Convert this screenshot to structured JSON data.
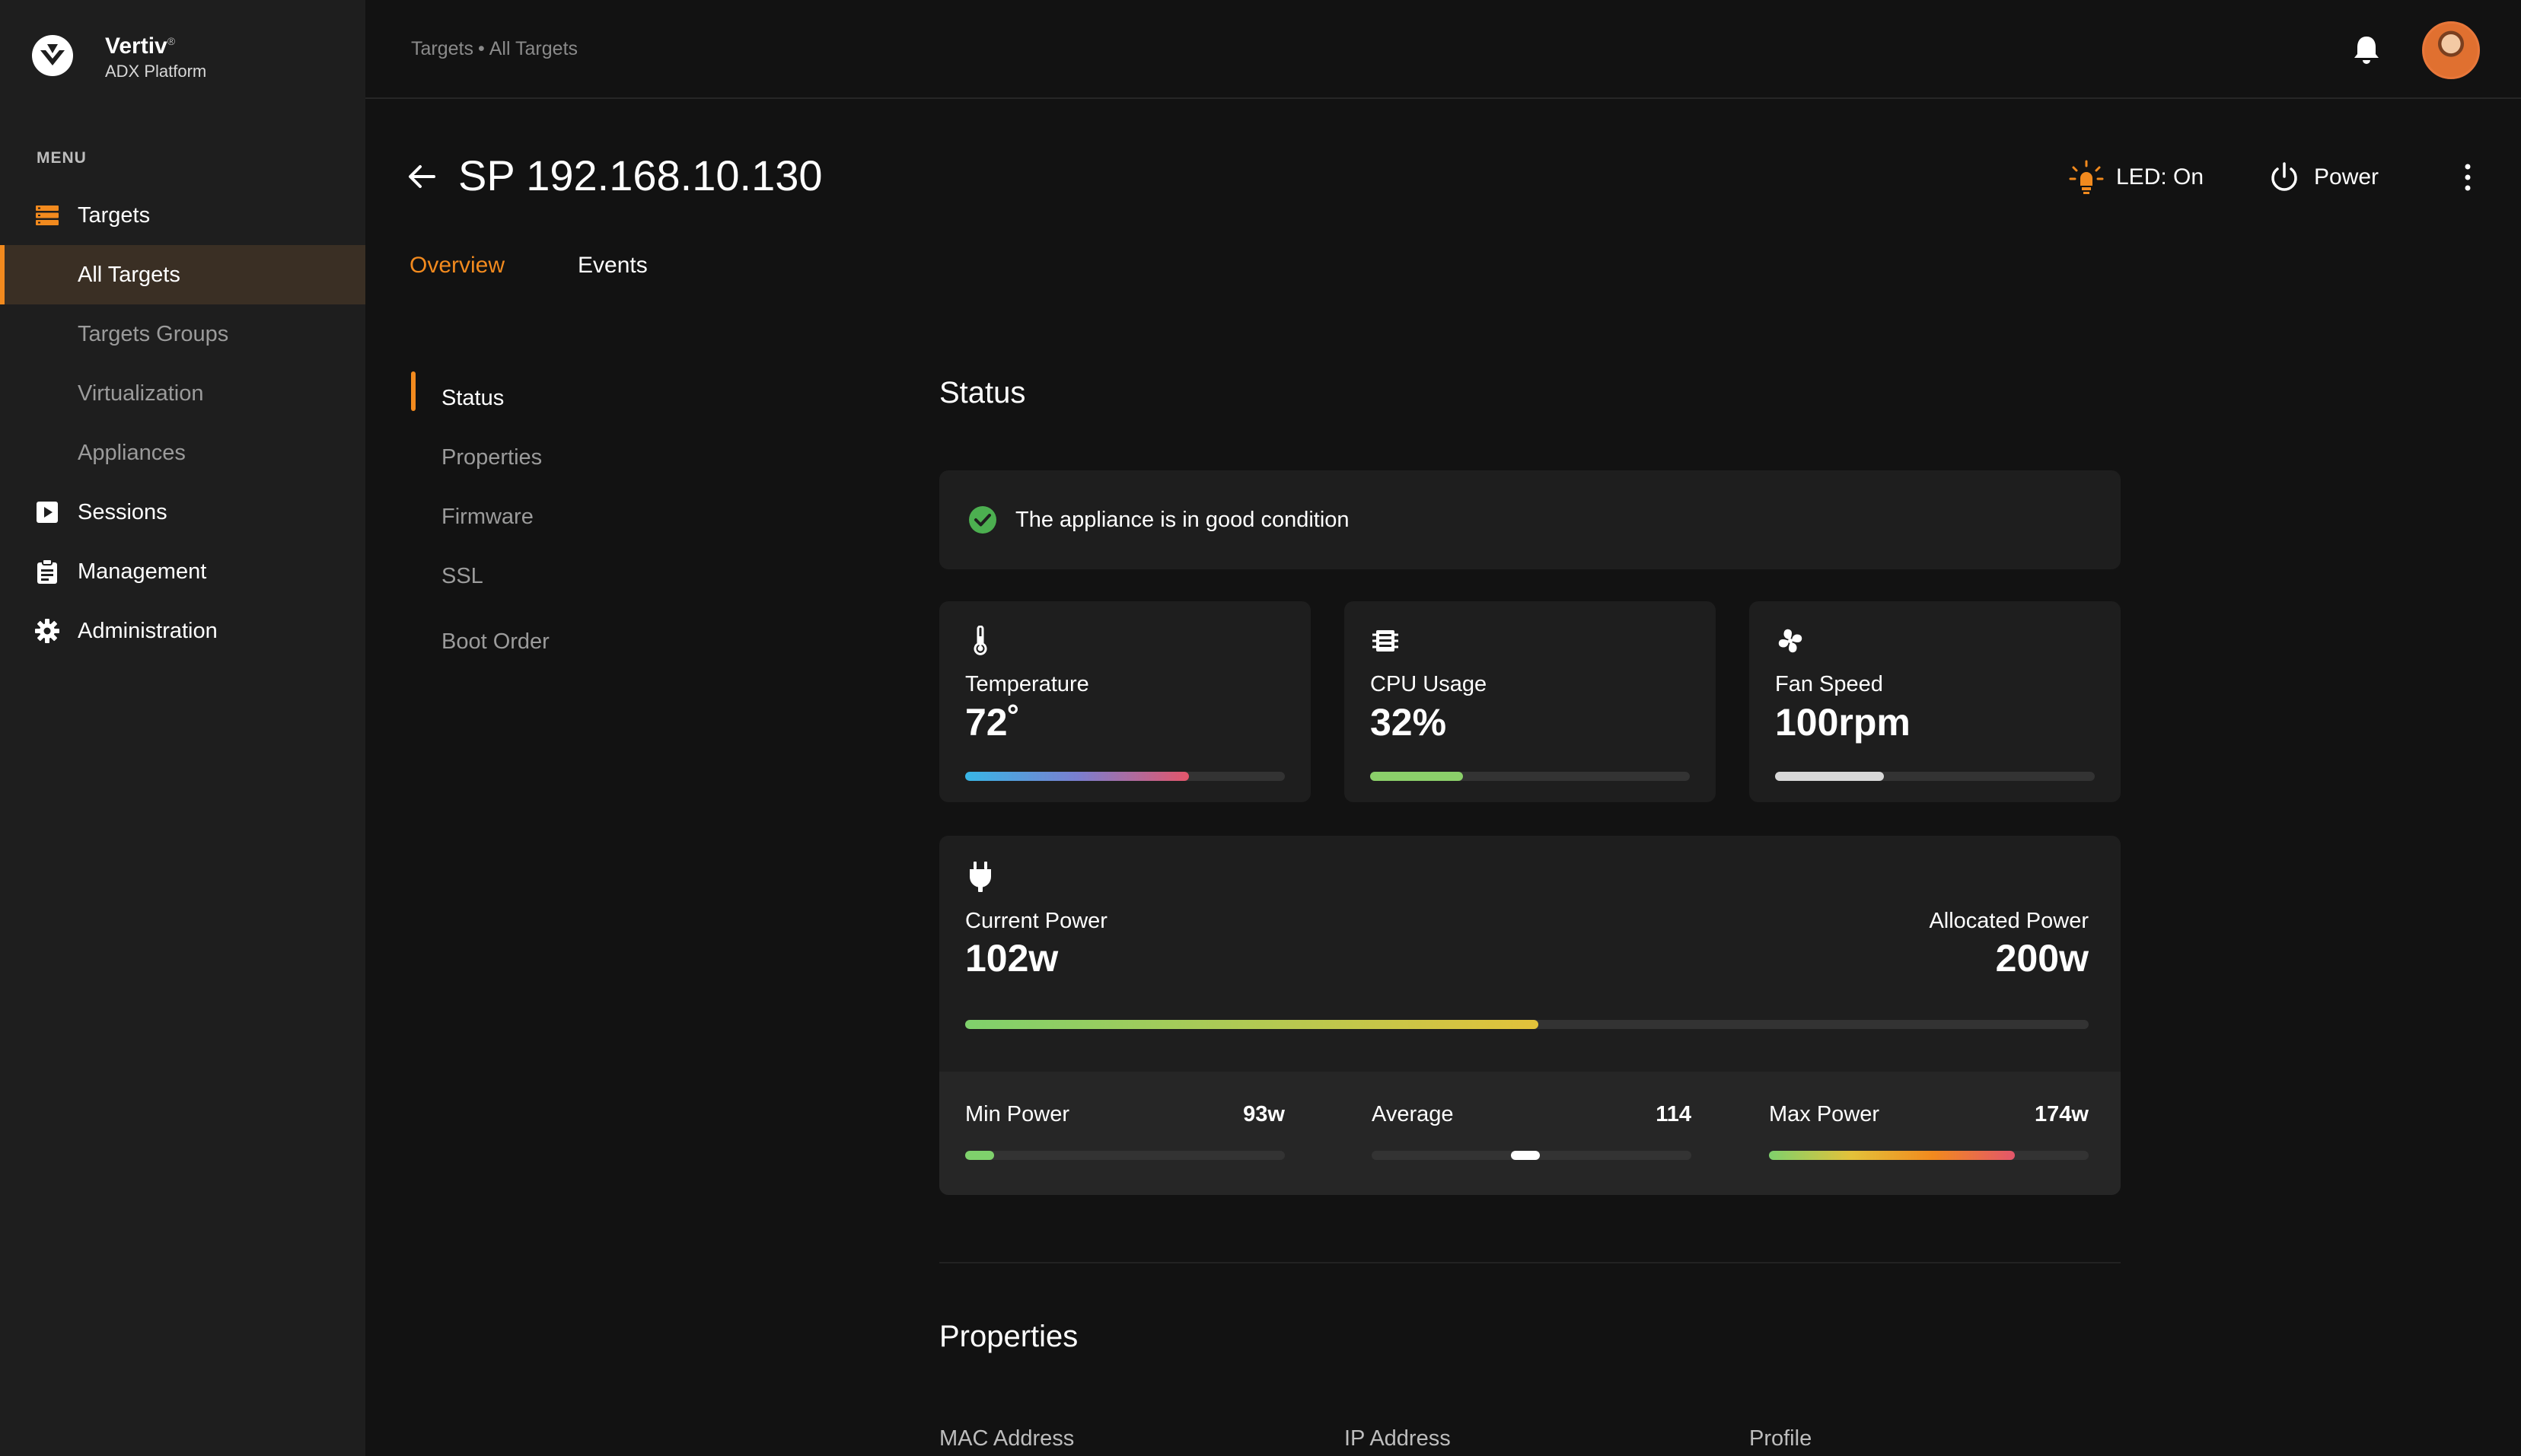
{
  "brand": {
    "name": "Vertiv",
    "mark": "®",
    "subtitle": "ADX Platform"
  },
  "sidebar": {
    "menu_title": "MENU",
    "items": [
      {
        "label": "Targets",
        "icon": "targets-icon"
      },
      {
        "label": "All Targets",
        "active": true
      },
      {
        "label": "Targets Groups"
      },
      {
        "label": "Virtualization"
      },
      {
        "label": "Appliances"
      },
      {
        "label": "Sessions",
        "icon": "sessions-icon"
      },
      {
        "label": "Management",
        "icon": "clipboard-icon"
      },
      {
        "label": "Administration",
        "icon": "gear-icon"
      }
    ]
  },
  "header": {
    "breadcrumb": [
      "Targets",
      "All Targets"
    ],
    "separator": "•"
  },
  "page": {
    "title": "SP 192.168.10.130",
    "led_label": "LED: On",
    "power_label": "Power",
    "tabs": [
      {
        "label": "Overview",
        "active": true
      },
      {
        "label": "Events"
      }
    ]
  },
  "section_nav": [
    "Status",
    "Properties",
    "Firmware",
    "SSL",
    "Boot Order"
  ],
  "status": {
    "heading": "Status",
    "condition": "The appliance is in good condition",
    "metrics": [
      {
        "label": "Temperature",
        "value": "72˚",
        "level": 0.7,
        "icon": "thermometer-icon"
      },
      {
        "label": "CPU Usage",
        "value": "32%",
        "level": 0.29,
        "icon": "chip-icon"
      },
      {
        "label": "Fan Speed",
        "value": "100rpm",
        "level": 0.34,
        "icon": "fan-icon"
      }
    ],
    "power": {
      "current_label": "Current Power",
      "current_value": "102w",
      "allocated_label": "Allocated Power",
      "allocated_value": "200w",
      "level": 0.51,
      "stats": [
        {
          "label": "Min Power",
          "value": "93w",
          "level": 0.09
        },
        {
          "label": "Average",
          "value": "114",
          "marker": 0.48
        },
        {
          "label": "Max Power",
          "value": "174w",
          "level": 0.77
        }
      ]
    }
  },
  "properties": {
    "heading": "Properties",
    "columns": [
      "MAC Address",
      "IP Address",
      "Profile"
    ]
  },
  "colors": {
    "accent": "#f28a1e",
    "success": "#4caf50",
    "background": "#121212",
    "sidebar": "#1e1e1e"
  }
}
